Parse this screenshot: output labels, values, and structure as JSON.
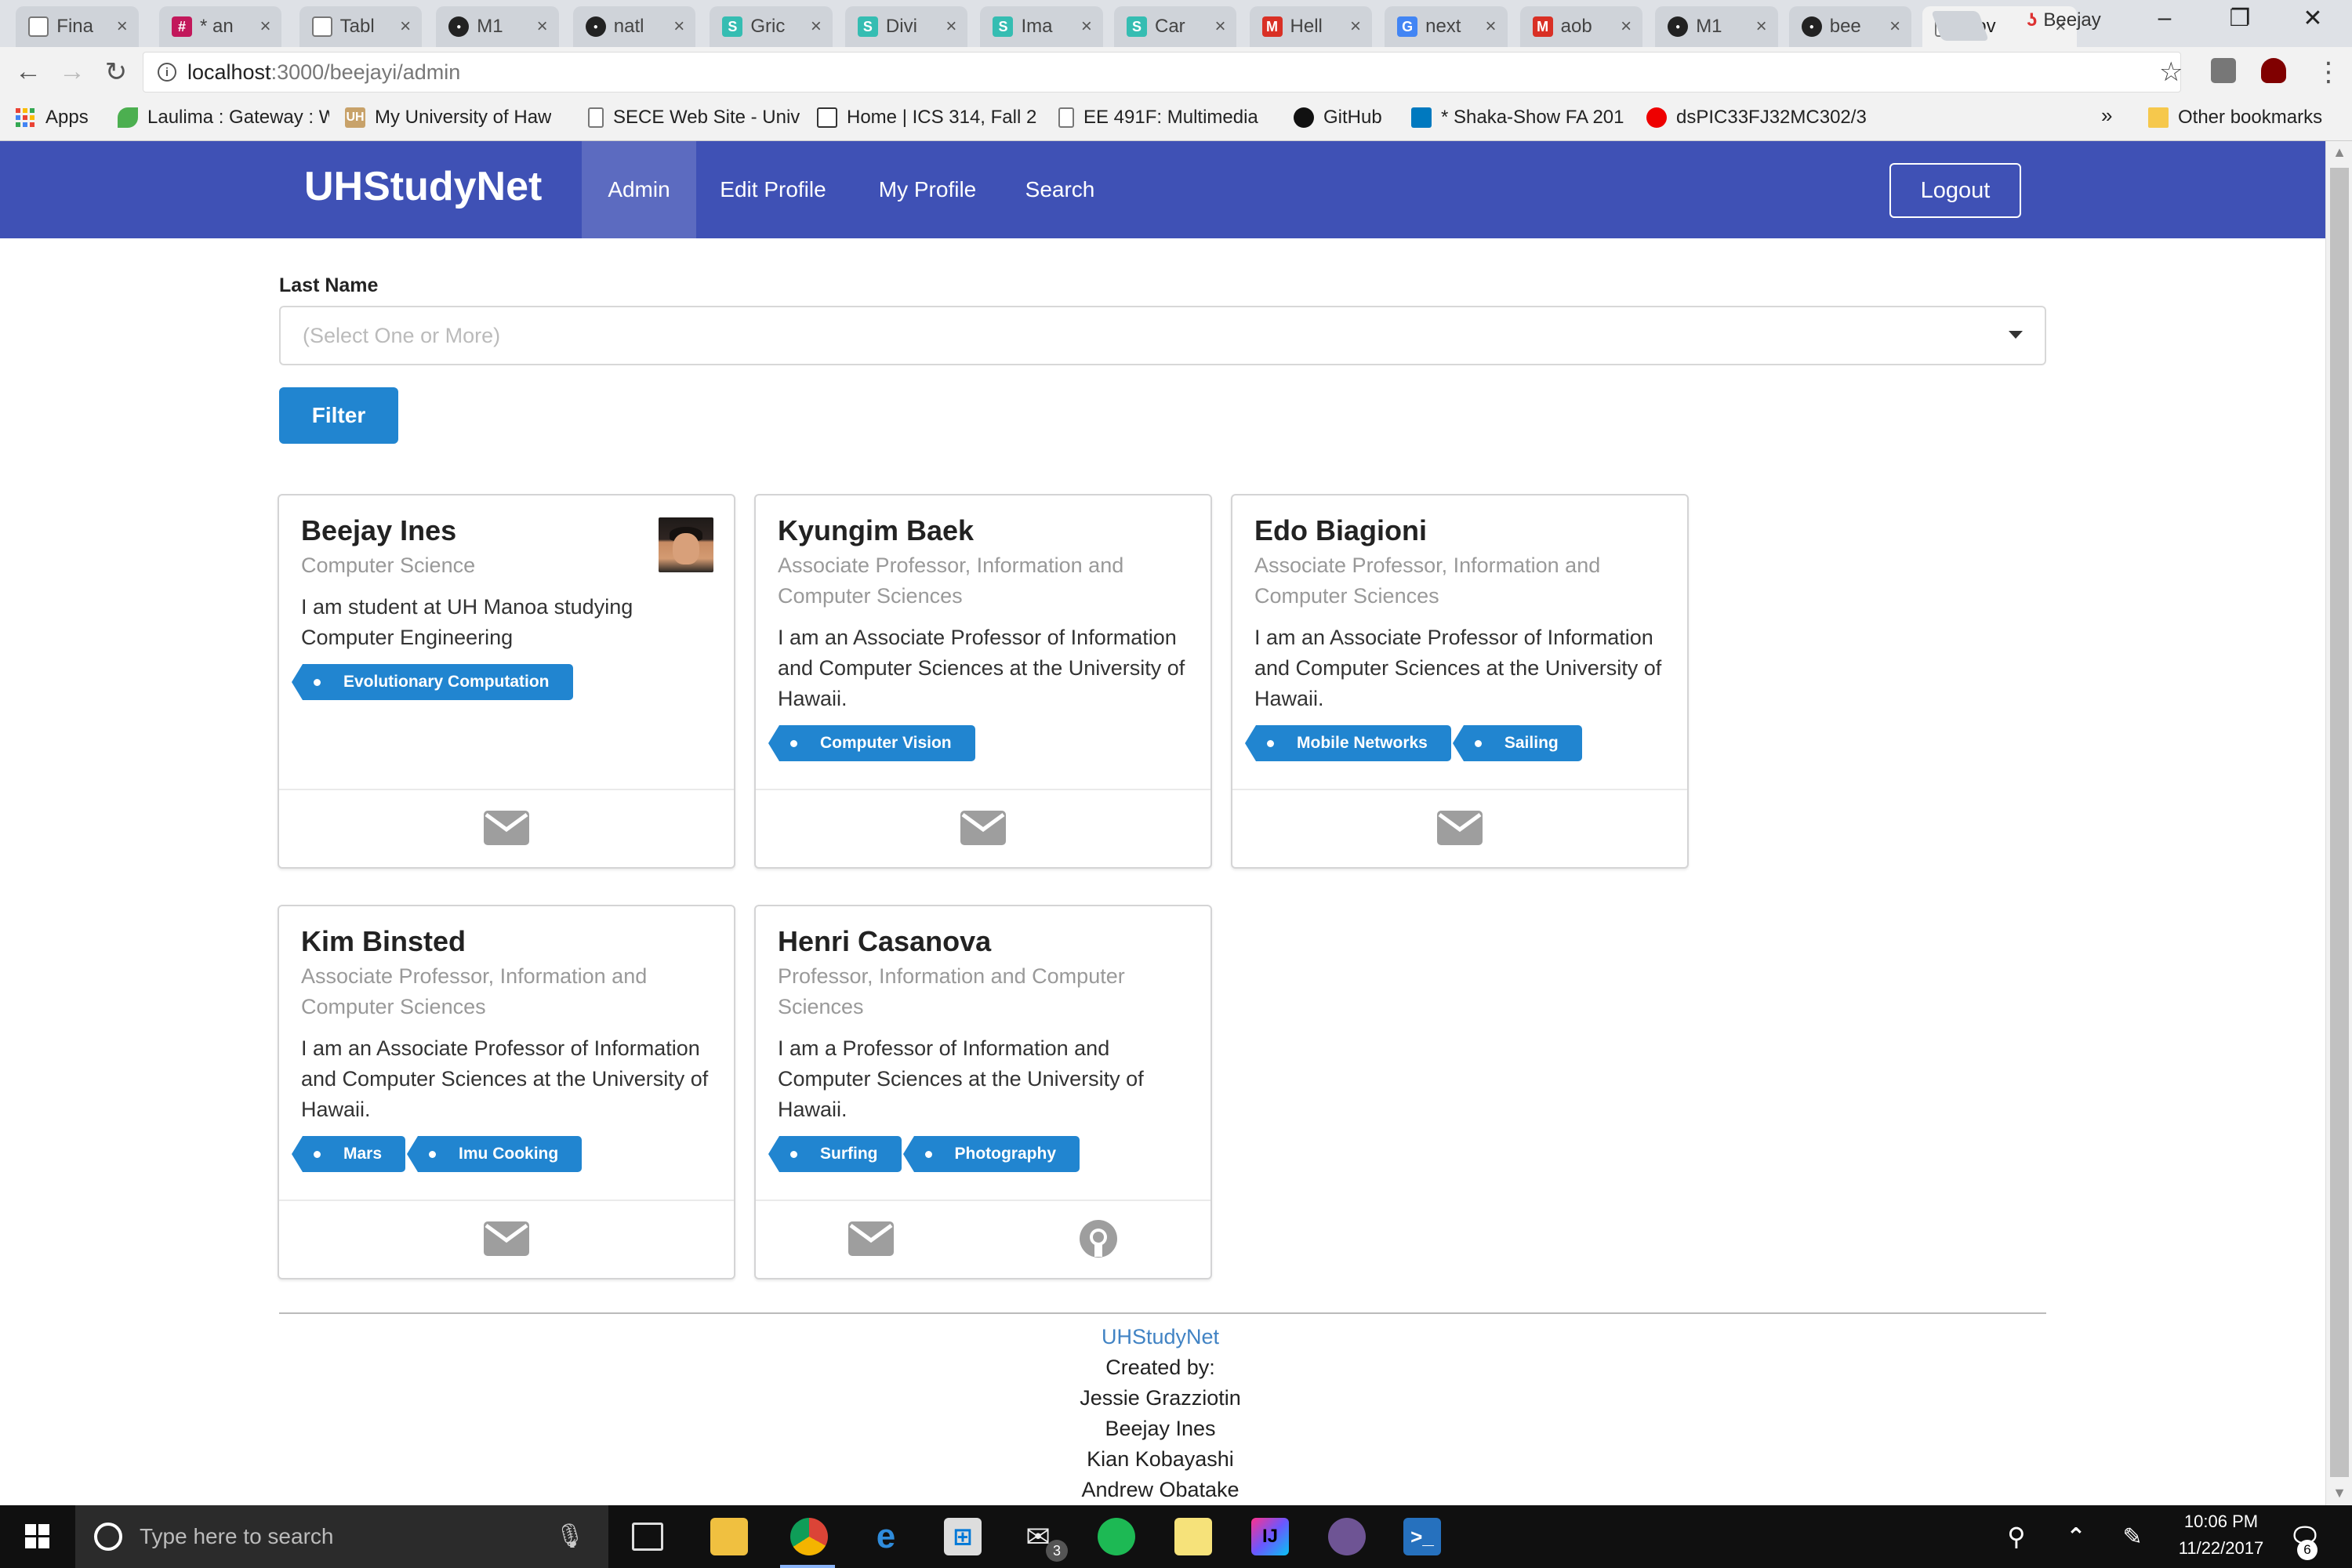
{
  "browser": {
    "tabs": [
      {
        "title": "Fina",
        "favicon": "doc-icon",
        "color": "#5b7bd5",
        "active": false
      },
      {
        "title": "* an",
        "favicon": "slack-icon",
        "color": "#c2185b",
        "active": false
      },
      {
        "title": "Tabl",
        "favicon": "doc-icon",
        "color": "#ffffff",
        "active": false
      },
      {
        "title": "M1",
        "favicon": "github-icon",
        "color": "#222222",
        "active": false
      },
      {
        "title": "natl",
        "favicon": "github-icon",
        "color": "#222222",
        "active": false
      },
      {
        "title": "Gric",
        "favicon": "s-icon",
        "color": "#35bdb2",
        "active": false
      },
      {
        "title": "Divi",
        "favicon": "s-icon",
        "color": "#35bdb2",
        "active": false
      },
      {
        "title": "Ima",
        "favicon": "s-icon",
        "color": "#35bdb2",
        "active": false
      },
      {
        "title": "Car",
        "favicon": "s-icon",
        "color": "#35bdb2",
        "active": false
      },
      {
        "title": "Hell",
        "favicon": "gmail-icon",
        "color": "#d93025",
        "active": false
      },
      {
        "title": "next",
        "favicon": "google-icon",
        "color": "#4285f4",
        "active": false
      },
      {
        "title": "aob",
        "favicon": "gmail-icon",
        "color": "#d93025",
        "active": false
      },
      {
        "title": "M1",
        "favicon": "github-icon",
        "color": "#222222",
        "active": false
      },
      {
        "title": "bee",
        "favicon": "github-icon",
        "color": "#222222",
        "active": false
      },
      {
        "title": "Bov",
        "favicon": "doc-icon",
        "color": "#ffffff",
        "active": true
      }
    ],
    "profile_name": "Beejay",
    "url_host": "localhost",
    "url_path": ":3000/beejayi/admin",
    "bookmarks": [
      {
        "label": "Apps",
        "icon": "apps-icon"
      },
      {
        "label": "Laulima : Gateway : W",
        "icon": "leaf-icon"
      },
      {
        "label": "My University of Haw",
        "icon": "uh-icon"
      },
      {
        "label": "SECE Web Site - Univ",
        "icon": "doc-icon"
      },
      {
        "label": "Home | ICS 314, Fall 2",
        "icon": "page-icon"
      },
      {
        "label": "EE 491F: Multimedia",
        "icon": "doc-icon"
      },
      {
        "label": "GitHub",
        "icon": "github-icon"
      },
      {
        "label": "* Shaka-Show FA 201",
        "icon": "trello-icon"
      },
      {
        "label": "dsPIC33FJ32MC302/3",
        "icon": "microchip-icon"
      }
    ],
    "other_bookmarks": "Other bookmarks",
    "overflow": "»"
  },
  "site": {
    "brand": "UHStudyNet",
    "nav": [
      {
        "label": "Admin",
        "active": true
      },
      {
        "label": "Edit Profile",
        "active": false
      },
      {
        "label": "My Profile",
        "active": false
      },
      {
        "label": "Search",
        "active": false
      }
    ],
    "logout_label": "Logout",
    "accent_color": "#3f51b5",
    "tag_color": "#2185d0"
  },
  "filter": {
    "label": "Last Name",
    "placeholder": "(Select One or More)",
    "button_label": "Filter"
  },
  "cards": [
    {
      "name": "Beejay Ines",
      "title": "Computer Science",
      "bio": "I am student at UH Manoa studying Computer Engineering",
      "tags": [
        "Evolutionary Computation"
      ],
      "has_avatar": true,
      "has_github": false
    },
    {
      "name": "Kyungim Baek",
      "title": "Associate Professor, Information and Computer Sciences",
      "bio": "I am an Associate Professor of Information and Computer Sciences at the University of Hawaii.",
      "tags": [
        "Computer Vision"
      ],
      "has_avatar": false,
      "has_github": false
    },
    {
      "name": "Edo Biagioni",
      "title": "Associate Professor, Information and Computer Sciences",
      "bio": "I am an Associate Professor of Information and Computer Sciences at the University of Hawaii.",
      "tags": [
        "Mobile Networks",
        "Sailing"
      ],
      "has_avatar": false,
      "has_github": false
    },
    {
      "name": "Kim Binsted",
      "title": "Associate Professor, Information and Computer Sciences",
      "bio": "I am an Associate Professor of Information and Computer Sciences at the University of Hawaii.",
      "tags": [
        "Mars",
        "Imu Cooking"
      ],
      "has_avatar": false,
      "has_github": false
    },
    {
      "name": "Henri Casanova",
      "title": "Professor, Information and Computer Sciences",
      "bio": "I am a Professor of Information and Computer Sciences at the University of Hawaii.",
      "tags": [
        "Surfing",
        "Photography"
      ],
      "has_avatar": false,
      "has_github": true
    }
  ],
  "footer": {
    "link": "UHStudyNet",
    "created_by": "Created by:",
    "authors": [
      "Jessie Grazziotin",
      "Beejay Ines",
      "Kian Kobayashi",
      "Andrew Obatake"
    ]
  },
  "taskbar": {
    "search_placeholder": "Type here to search",
    "time": "10:06 PM",
    "date": "11/22/2017",
    "mail_badge": "3",
    "notification_count": "6"
  }
}
